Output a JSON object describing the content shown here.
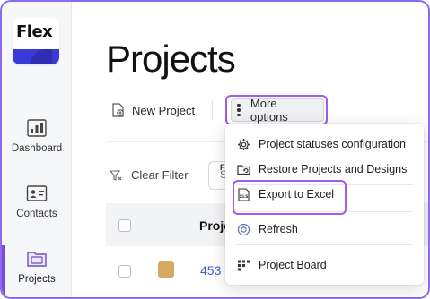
{
  "logo": {
    "text": "Flex"
  },
  "sidebar": {
    "items": [
      {
        "label": "Dashboard",
        "icon": "dashboard-icon"
      },
      {
        "label": "Contacts",
        "icon": "contacts-icon"
      },
      {
        "label": "Projects",
        "icon": "projects-icon",
        "active": true
      }
    ]
  },
  "page": {
    "title": "Projects"
  },
  "toolbar": {
    "new_project_label": "New Project",
    "more_options_label": "More options"
  },
  "filter": {
    "clear_label": "Clear Filter",
    "search_stub_letter": "F",
    "search_stub_text": "S"
  },
  "table": {
    "header_project": "Proje",
    "rows": [
      {
        "number": "453"
      }
    ]
  },
  "menu": {
    "items": [
      {
        "label": "Project statuses configuration",
        "icon": "gear-icon"
      },
      {
        "label": "Restore Projects and Designs",
        "icon": "folder-restore-icon"
      },
      {
        "label": "Export to Excel",
        "icon": "xls-file-icon"
      },
      {
        "label": "Refresh",
        "icon": "refresh-icon"
      },
      {
        "label": "Project Board",
        "icon": "board-icon"
      }
    ]
  },
  "colors": {
    "accent_outline": "#a35be8",
    "active_nav_bar": "#7c4ddb",
    "logo_band": "#3a3ad6",
    "link_blue": "#3f5bd8",
    "swatch": "#d7a960"
  }
}
